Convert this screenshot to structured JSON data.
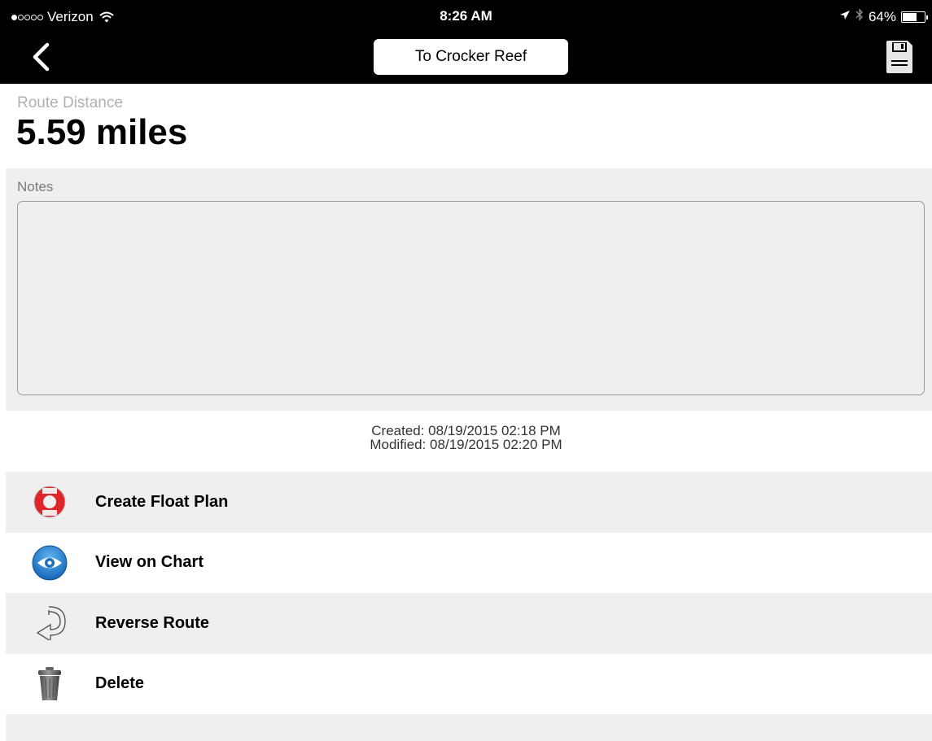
{
  "status_bar": {
    "carrier": "Verizon",
    "time": "8:26 AM",
    "battery_percent": "64%",
    "battery_level": 0.64
  },
  "nav": {
    "title": "To Crocker Reef"
  },
  "route": {
    "distance_label": "Route Distance",
    "distance_value": "5.59 miles"
  },
  "notes": {
    "label": "Notes",
    "value": ""
  },
  "meta": {
    "created": "Created: 08/19/2015 02:18 PM",
    "modified": "Modified: 08/19/2015 02:20 PM"
  },
  "actions": [
    {
      "label": "Create Float Plan",
      "icon": "life-ring-icon"
    },
    {
      "label": "View on Chart",
      "icon": "eye-icon"
    },
    {
      "label": "Reverse Route",
      "icon": "reverse-arrow-icon"
    },
    {
      "label": "Delete",
      "icon": "trash-icon"
    }
  ],
  "colors": {
    "bar_background": "#000000",
    "row_shade": "#efefef",
    "life_ring_red": "#e0262b",
    "eye_blue": "#2a8fd8"
  }
}
